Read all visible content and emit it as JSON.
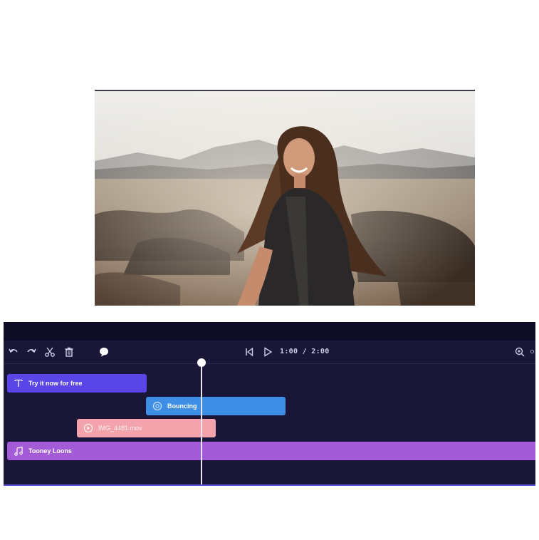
{
  "preview": {
    "image_description_icon": "photo-woman-smiling-landscape"
  },
  "toolbar": {
    "undo_icon": "undo-icon",
    "redo_icon": "redo-icon",
    "split_icon": "scissors-icon",
    "delete_icon": "trash-icon",
    "comment_icon": "comment-bubble-icon",
    "skip_back_icon": "skip-back-icon",
    "play_icon": "play-icon",
    "timecode": "1:00 / 2:00",
    "zoom_icon": "zoom-in-icon"
  },
  "tracks": [
    {
      "type": "text",
      "icon": "text-icon",
      "label": "Try it now for free",
      "color": "#5a45e6"
    },
    {
      "type": "effect",
      "icon": "effect-circle-icon",
      "label": "Bouncing",
      "color": "#3f8ee6"
    },
    {
      "type": "video",
      "icon": "video-clip-icon",
      "label": "IMG_4481.mov",
      "color": "#f2a3ac"
    },
    {
      "type": "audio",
      "icon": "music-note-icon",
      "label": "Tooney Loons",
      "color": "#a45bd8"
    }
  ],
  "colors": {
    "editor_background": "#191638",
    "playhead": "#ffffff"
  }
}
